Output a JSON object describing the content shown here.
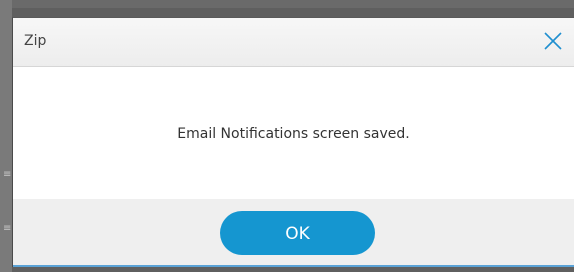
{
  "dialog": {
    "title": "Zip",
    "message": "Email Notifications screen saved.",
    "ok_label": "OK",
    "close_icon": "close-icon"
  },
  "colors": {
    "primary_button": "#1596d0",
    "header_bg": "#f0f0f0",
    "footer_bg": "#efefef",
    "overlay": "#5f5f5f"
  }
}
